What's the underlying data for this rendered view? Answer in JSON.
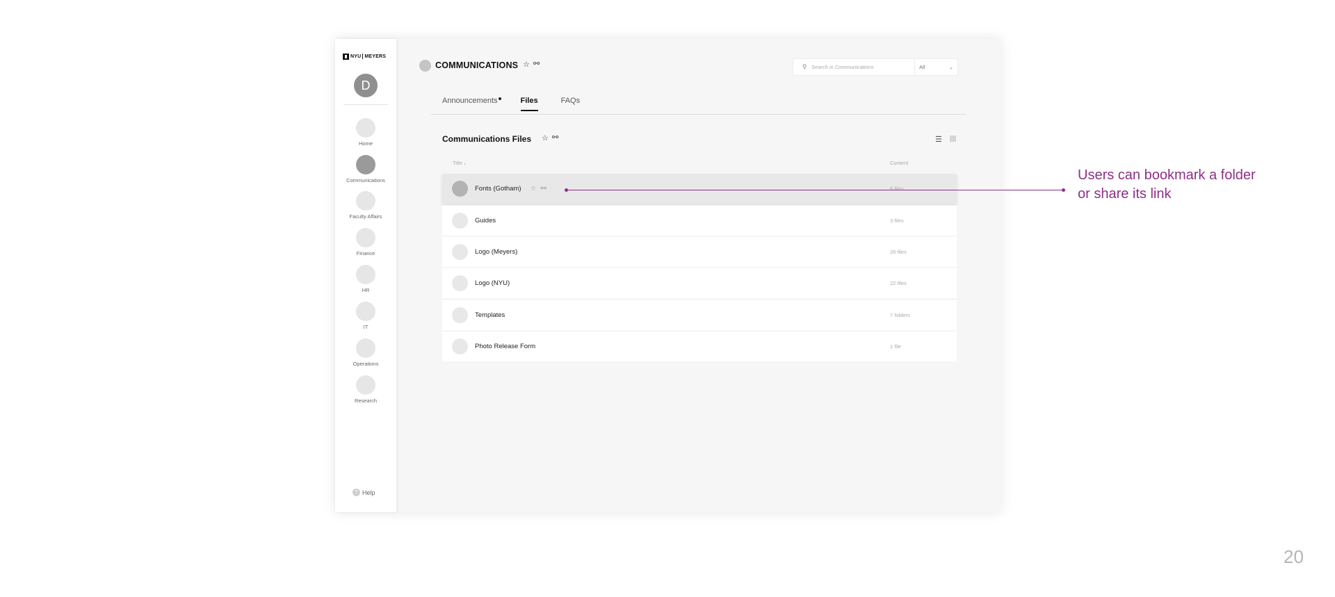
{
  "sidebar": {
    "logo_left": "NYU",
    "logo_right": "MEYERS",
    "user_initial": "D",
    "items": [
      {
        "label": "Home"
      },
      {
        "label": "Communications"
      },
      {
        "label": "Faculty Affairs"
      },
      {
        "label": "Finance"
      },
      {
        "label": "HR"
      },
      {
        "label": "IT"
      },
      {
        "label": "Operations"
      },
      {
        "label": "Research"
      }
    ],
    "help_label": "Help"
  },
  "header": {
    "title": "COMMUNICATIONS",
    "search_placeholder": "Search in Communications",
    "filter_value": "All"
  },
  "tabs": [
    {
      "label": "Announcements",
      "active": false,
      "has_dot": true
    },
    {
      "label": "Files",
      "active": true
    },
    {
      "label": "FAQs",
      "active": false
    }
  ],
  "section": {
    "title": "Communications Files",
    "col_title": "Title ↓",
    "col_content": "Content"
  },
  "rows": [
    {
      "name": "Fonts (Gotham)",
      "count": "6 files"
    },
    {
      "name": "Guides",
      "count": "3 files"
    },
    {
      "name": "Logo (Meyers)",
      "count": "26 files"
    },
    {
      "name": "Logo (NYU)",
      "count": "22 files"
    },
    {
      "name": "Templates",
      "count": "7 folders"
    },
    {
      "name": "Photo Release Form",
      "count": "1 file"
    }
  ],
  "annotation": {
    "line1": "Users can bookmark a folder",
    "line2": "or share its link",
    "color": "#8e2f89"
  },
  "page_number": "20"
}
